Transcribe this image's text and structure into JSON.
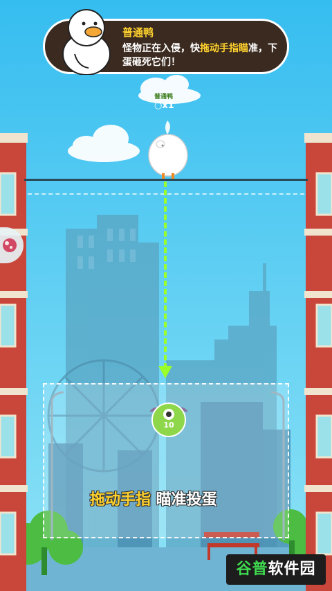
{
  "speech": {
    "speaker": "普通鸭",
    "message_prefix": "怪物正在入侵，快",
    "message_highlight": "拖动手指瞄",
    "message_suffix": "准，下蛋砸死它们！"
  },
  "duck": {
    "label": "普通鸭",
    "egg_count": "○x1"
  },
  "monster_badge": {
    "value": "10"
  },
  "instruction": {
    "highlight": "拖动手指",
    "rest": " 瞄准投蛋"
  },
  "watermark": {
    "part1": "谷普",
    "part2": "软件园"
  },
  "colors": {
    "sky": "#3cc3ef",
    "aim_line": "#9bff2a",
    "highlight": "#ffd22e",
    "building_brick": "#c9463a"
  },
  "icons": {
    "left_side": "food-icon"
  }
}
